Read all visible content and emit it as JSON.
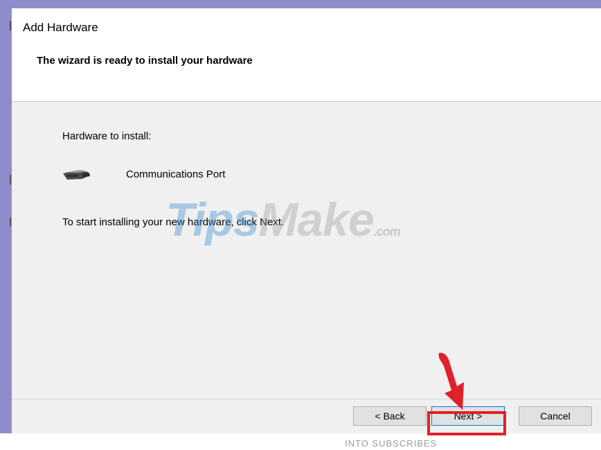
{
  "window": {
    "title": "Add Hardware",
    "subtitle": "The wizard is ready to install your hardware"
  },
  "content": {
    "hardware_label": "Hardware to install:",
    "device_name": "Communications Port",
    "device_icon": "serial-port-icon",
    "instruction": "To start installing your new hardware, click Next."
  },
  "buttons": {
    "back_label": "< Back",
    "next_label": "Next >",
    "cancel_label": "Cancel"
  },
  "watermark": {
    "tips": "Tips",
    "make": "Make",
    "domain": ".com"
  },
  "background_text": "INTO SUBSCRIBES",
  "colors": {
    "frame": "#8f8ccc",
    "highlight": "#e0202a",
    "window_bg": "#f0f0f0"
  }
}
